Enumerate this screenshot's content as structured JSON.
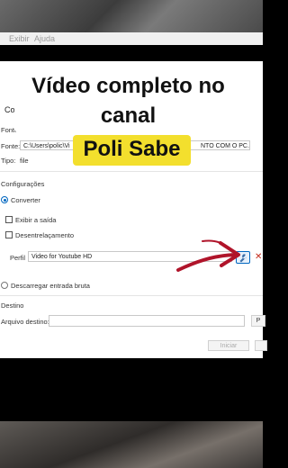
{
  "menu": {
    "items": [
      "Exibir",
      "Ajuda"
    ]
  },
  "overlay": {
    "line1": "Vídeo completo no",
    "line2": "canal",
    "highlight": "Poli Sabe"
  },
  "dialog": {
    "title": "Converter",
    "close_glyph": "×",
    "source_section": "Fonte",
    "source_label": "Fonte:",
    "source_path_start": "C:\\Users\\polic\\Vi",
    "source_path_end": "NTO COM O PC.mkv",
    "type_label": "Tipo:",
    "type_value": "file",
    "settings_section": "Configurações",
    "convert_option": "Converter",
    "show_output_label": "Exibir a saída",
    "deinterlace_label": "Desentrelaçamento",
    "profile_label": "Perfil",
    "profile_value": "Video for Youtube HD",
    "raw_dump_label": "Descarregar entrada bruta",
    "destination_section": "Destino",
    "dest_file_label": "Arquivo destino:",
    "browse_label": "P",
    "start_label": "Iniciar",
    "delete_glyph": "✕"
  },
  "icons": {
    "profile_edit": "wrench-icon",
    "profile_delete": "delete-icon",
    "annotation": "red-arrow-icon"
  },
  "colors": {
    "accent": "#0067c0",
    "highlight": "#f3df2d",
    "arrow": "#b0142a"
  }
}
